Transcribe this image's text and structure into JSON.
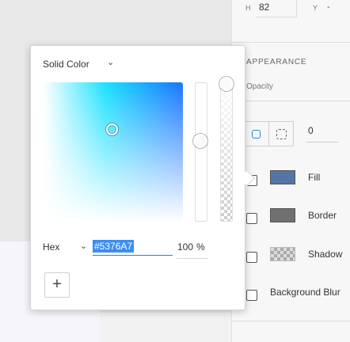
{
  "panel": {
    "h_label": "H",
    "h_value": "82",
    "y_label": "Y",
    "y_value": "-",
    "appearance_title": "APPEARANCE",
    "opacity_label": "Opacity",
    "corner_radius_value": "0",
    "properties": [
      {
        "label": "Fill",
        "color": "#5376A7",
        "checked": false
      },
      {
        "label": "Border",
        "color": "#707070",
        "checked": false
      },
      {
        "label": "Shadow",
        "color": "checkered",
        "checked": false
      },
      {
        "label": "Background Blur",
        "color": "",
        "checked": false
      }
    ]
  },
  "picker": {
    "mode_label": "Solid Color",
    "format_label": "Hex",
    "hex_value": "#5376A7",
    "alpha_value": "100",
    "alpha_unit": "%",
    "add_label": "+",
    "colors": {
      "accent": "#2680eb",
      "field_hue": "#1a73ff"
    }
  },
  "icons": {
    "mode_dropdown": "chevron-down-icon",
    "format_dropdown": "chevron-down-icon",
    "add": "plus-icon",
    "radius_single": "rounded-square-icon",
    "radius_individual": "dashed-square-icon"
  }
}
